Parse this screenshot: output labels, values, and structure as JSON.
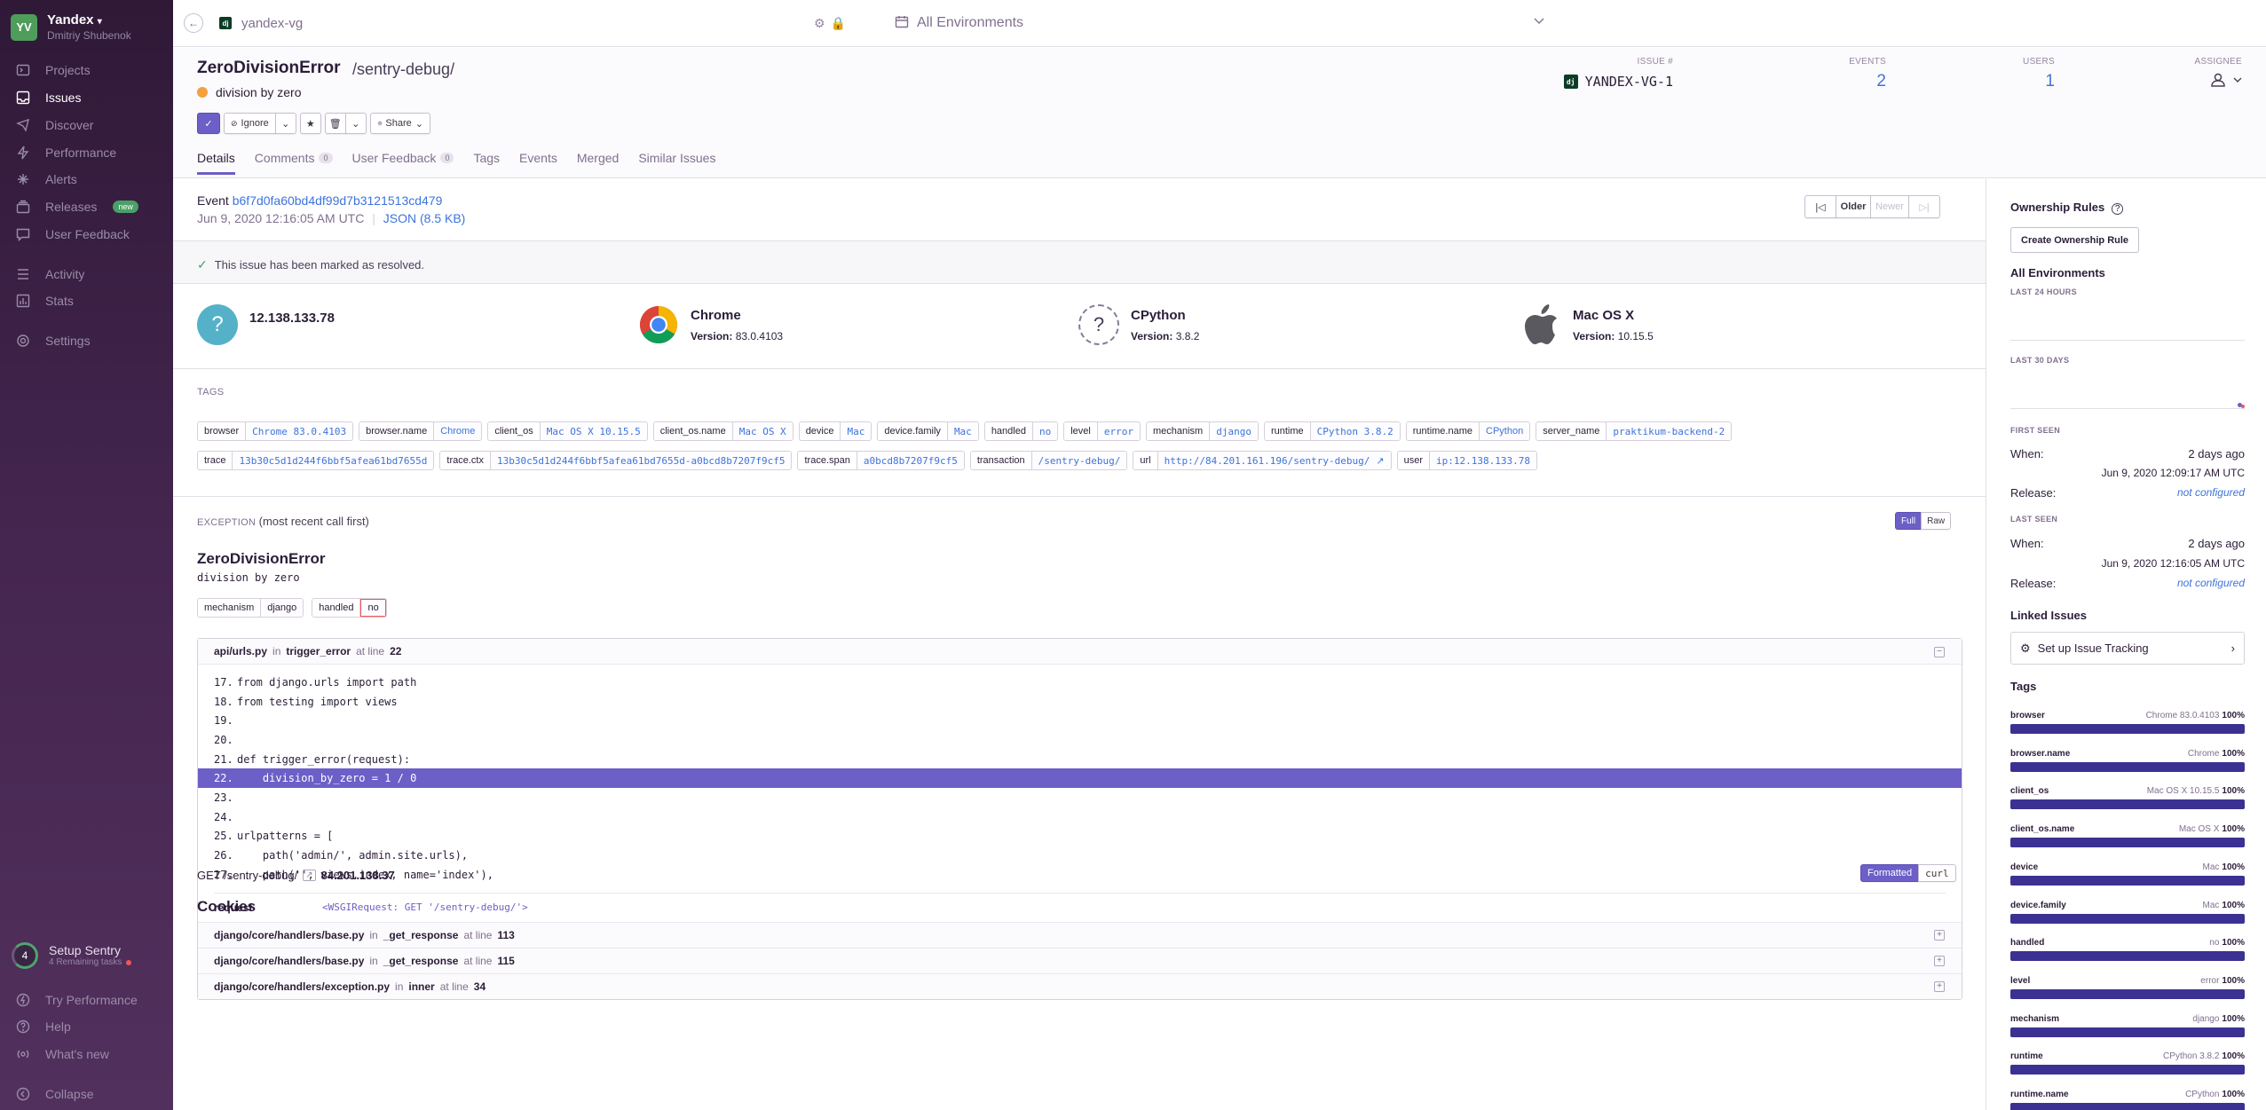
{
  "org": {
    "initials": "YV",
    "name": "Yandex",
    "user": "Dmitriy Shubenok"
  },
  "nav": {
    "projects": "Projects",
    "issues": "Issues",
    "discover": "Discover",
    "performance": "Performance",
    "alerts": "Alerts",
    "releases": "Releases",
    "releases_badge": "new",
    "user_feedback": "User Feedback",
    "activity": "Activity",
    "stats": "Stats",
    "settings": "Settings"
  },
  "setup": {
    "count": "4",
    "title": "Setup Sentry",
    "sub": "4 Remaining tasks"
  },
  "bottom_nav": {
    "try_performance": "Try Performance",
    "help": "Help",
    "whats_new": "What's new",
    "collapse": "Collapse"
  },
  "topbar": {
    "project_icon": "dj",
    "project": "yandex-vg",
    "environment": "All Environments"
  },
  "issue": {
    "title": "ZeroDivisionError",
    "culprit": "/sentry-debug/",
    "message": "division by zero",
    "actions": {
      "ignore": "Ignore",
      "share": "Share"
    },
    "tabs": [
      {
        "label": "Details"
      },
      {
        "label": "Comments",
        "count": "0"
      },
      {
        "label": "User Feedback",
        "count": "0"
      },
      {
        "label": "Tags"
      },
      {
        "label": "Events"
      },
      {
        "label": "Merged"
      },
      {
        "label": "Similar Issues"
      }
    ],
    "stats": {
      "issue_label": "ISSUE #",
      "issue_icon": "dj",
      "issue_value": "YANDEX-VG-1",
      "events_label": "EVENTS",
      "events_value": "2",
      "users_label": "USERS",
      "users_value": "1",
      "assignee_label": "ASSIGNEE"
    }
  },
  "event": {
    "label": "Event",
    "id": "b6f7d0fa60bd4df99d7b3121513cd479",
    "date": "Jun 9, 2020 12:16:05 AM UTC",
    "json": "JSON (8.5 KB)",
    "older": "Older",
    "newer": "Newer",
    "resolved_msg": "This issue has been marked as resolved."
  },
  "contexts": [
    {
      "title": "12.138.133.78",
      "version_label": "",
      "version": "",
      "icon": "question-icon"
    },
    {
      "title": "Chrome",
      "version_label": "Version:",
      "version": "83.0.4103",
      "icon": "chrome-icon"
    },
    {
      "title": "CPython",
      "version_label": "Version:",
      "version": "3.8.2",
      "icon": "python-unknown-icon"
    },
    {
      "title": "Mac OS X",
      "version_label": "Version:",
      "version": "10.15.5",
      "icon": "apple-icon"
    }
  ],
  "tags_title": "TAGS",
  "tags_row1": [
    {
      "k": "browser",
      "v": "Chrome 83.0.4103",
      "mono": true
    },
    {
      "k": "browser.name",
      "v": "Chrome",
      "mono": false
    },
    {
      "k": "client_os",
      "v": "Mac OS X 10.15.5",
      "mono": true
    },
    {
      "k": "client_os.name",
      "v": "Mac OS X",
      "mono": true
    },
    {
      "k": "device",
      "v": "Mac",
      "mono": true
    },
    {
      "k": "device.family",
      "v": "Mac",
      "mono": true
    },
    {
      "k": "handled",
      "v": "no",
      "mono": true
    },
    {
      "k": "level",
      "v": "error",
      "mono": true
    },
    {
      "k": "mechanism",
      "v": "django",
      "mono": true
    },
    {
      "k": "runtime",
      "v": "CPython 3.8.2",
      "mono": true
    },
    {
      "k": "runtime.name",
      "v": "CPython",
      "mono": false
    },
    {
      "k": "server_name",
      "v": "praktikum-backend-2",
      "mono": true
    }
  ],
  "tags_row2": [
    {
      "k": "trace",
      "v": "13b30c5d1d244f6bbf5afea61bd7655d",
      "mono": true
    },
    {
      "k": "trace.ctx",
      "v": "13b30c5d1d244f6bbf5afea61bd7655d-a0bcd8b7207f9cf5",
      "mono": true
    },
    {
      "k": "trace.span",
      "v": "a0bcd8b7207f9cf5",
      "mono": true
    },
    {
      "k": "transaction",
      "v": "/sentry-debug/",
      "mono": true
    },
    {
      "k": "url",
      "v": "http://84.201.161.196/sentry-debug/",
      "mono": true,
      "ext": true
    },
    {
      "k": "user",
      "v": "ip:12.138.133.78",
      "mono": true
    }
  ],
  "exception": {
    "header": "EXCEPTION",
    "header_note": "(most recent call first)",
    "full": "Full",
    "raw": "Raw",
    "type": "ZeroDivisionError",
    "value": "division by zero",
    "mech_k": "mechanism",
    "mech_v": "django",
    "handled_k": "handled",
    "handled_v": "no",
    "frame": {
      "file": "api/urls.py",
      "in": "in",
      "func": "trigger_error",
      "at": "at line",
      "line": "22"
    },
    "code": [
      {
        "n": "17.",
        "t": "from django.urls import path"
      },
      {
        "n": "18.",
        "t": "from testing import views"
      },
      {
        "n": "19.",
        "t": ""
      },
      {
        "n": "20.",
        "t": ""
      },
      {
        "n": "21.",
        "t": "def trigger_error(request):"
      },
      {
        "n": "22.",
        "t": "    division_by_zero = 1 / 0"
      },
      {
        "n": "23.",
        "t": ""
      },
      {
        "n": "24.",
        "t": ""
      },
      {
        "n": "25.",
        "t": "urlpatterns = ["
      },
      {
        "n": "26.",
        "t": "    path('admin/', admin.site.urls),"
      },
      {
        "n": "27.",
        "t": "    path('', views.index, name='index'),"
      }
    ],
    "var_k": "request",
    "var_v": "<WSGIRequest: GET '/sentry-debug/'>",
    "frames": [
      {
        "file": "django/core/handlers/base.py",
        "in": "in",
        "func": "_get_response",
        "at": "at line",
        "line": "113"
      },
      {
        "file": "django/core/handlers/base.py",
        "in": "in",
        "func": "_get_response",
        "at": "at line",
        "line": "115"
      },
      {
        "file": "django/core/handlers/exception.py",
        "in": "in",
        "func": "inner",
        "at": "at line",
        "line": "34"
      }
    ]
  },
  "request": {
    "method_path": "GET /sentry-debug/",
    "ip": "84.201.138.37",
    "formatted": "Formatted",
    "curl": "curl",
    "cookies": "Cookies"
  },
  "right": {
    "ownership": "Ownership Rules",
    "create_rule": "Create Ownership Rule",
    "all_env": "All Environments",
    "last24": "LAST 24 HOURS",
    "last30": "LAST 30 DAYS",
    "first_seen": "FIRST SEEN",
    "last_seen": "LAST SEEN",
    "when": "When:",
    "release": "Release:",
    "ago": "2 days ago",
    "first_date": "Jun 9, 2020 12:09:17 AM UTC",
    "last_date": "Jun 9, 2020 12:16:05 AM UTC",
    "not_configured": "not configured",
    "linked": "Linked Issues",
    "tracking": "Set up Issue Tracking",
    "tags": "Tags",
    "tag_list": [
      {
        "k": "browser",
        "v": "Chrome 83.0.4103",
        "p": "100%"
      },
      {
        "k": "browser.name",
        "v": "Chrome",
        "p": "100%"
      },
      {
        "k": "client_os",
        "v": "Mac OS X 10.15.5",
        "p": "100%"
      },
      {
        "k": "client_os.name",
        "v": "Mac OS X",
        "p": "100%"
      },
      {
        "k": "device",
        "v": "Mac",
        "p": "100%"
      },
      {
        "k": "device.family",
        "v": "Mac",
        "p": "100%"
      },
      {
        "k": "handled",
        "v": "no",
        "p": "100%"
      },
      {
        "k": "level",
        "v": "error",
        "p": "100%"
      },
      {
        "k": "mechanism",
        "v": "django",
        "p": "100%"
      },
      {
        "k": "runtime",
        "v": "CPython 3.8.2",
        "p": "100%"
      },
      {
        "k": "runtime.name",
        "v": "CPython",
        "p": "100%"
      }
    ]
  },
  "colors": {
    "accent": "#6c5fc7",
    "link": "#3d74db",
    "warning": "#f5a03a",
    "success": "#4aa066"
  }
}
